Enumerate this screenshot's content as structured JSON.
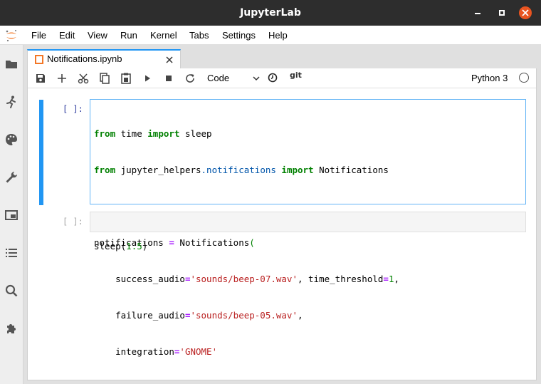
{
  "window": {
    "title": "JupyterLab"
  },
  "menubar": {
    "items": [
      "File",
      "Edit",
      "View",
      "Run",
      "Kernel",
      "Tabs",
      "Settings",
      "Help"
    ]
  },
  "tab": {
    "label": "Notifications.ipynb"
  },
  "toolbar": {
    "cell_type": "Code",
    "git_label": "git",
    "kernel_name": "Python 3"
  },
  "cells": [
    {
      "prompt": "[ ]:",
      "source": [
        "from time import sleep",
        "from jupyter_helpers.notifications import Notifications",
        "",
        "notifications = Notifications(",
        "    success_audio='sounds/beep-07.wav', time_threshold=1,",
        "    failure_audio='sounds/beep-05.wav',",
        "    integration='GNOME'",
        ")"
      ]
    },
    {
      "prompt": "[ ]:",
      "source": [
        "sleep(1.5)"
      ]
    }
  ],
  "colors": {
    "accent": "#2196f3",
    "titlebar": "#2d2d2d",
    "close": "#e95420"
  }
}
